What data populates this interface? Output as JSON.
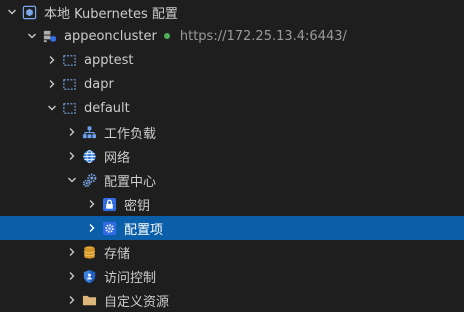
{
  "root": {
    "label": "本地 Kubernetes 配置"
  },
  "cluster": {
    "name": "appeoncluster",
    "url": "https://172.25.13.4:6443/",
    "status_color": "#4fb05a"
  },
  "namespaces": [
    {
      "label": "apptest"
    },
    {
      "label": "dapr"
    },
    {
      "label": "default"
    }
  ],
  "resources": {
    "workloads": "工作负载",
    "network": "网络",
    "config_center": "配置中心",
    "secrets": "密钥",
    "config_items": "配置项",
    "storage": "存储",
    "access_control": "访问控制",
    "custom_resources": "自定义资源"
  },
  "colors": {
    "selected": "#0a5fa8",
    "kube_blue": "#326ce5",
    "folder": "#dcb67a"
  }
}
